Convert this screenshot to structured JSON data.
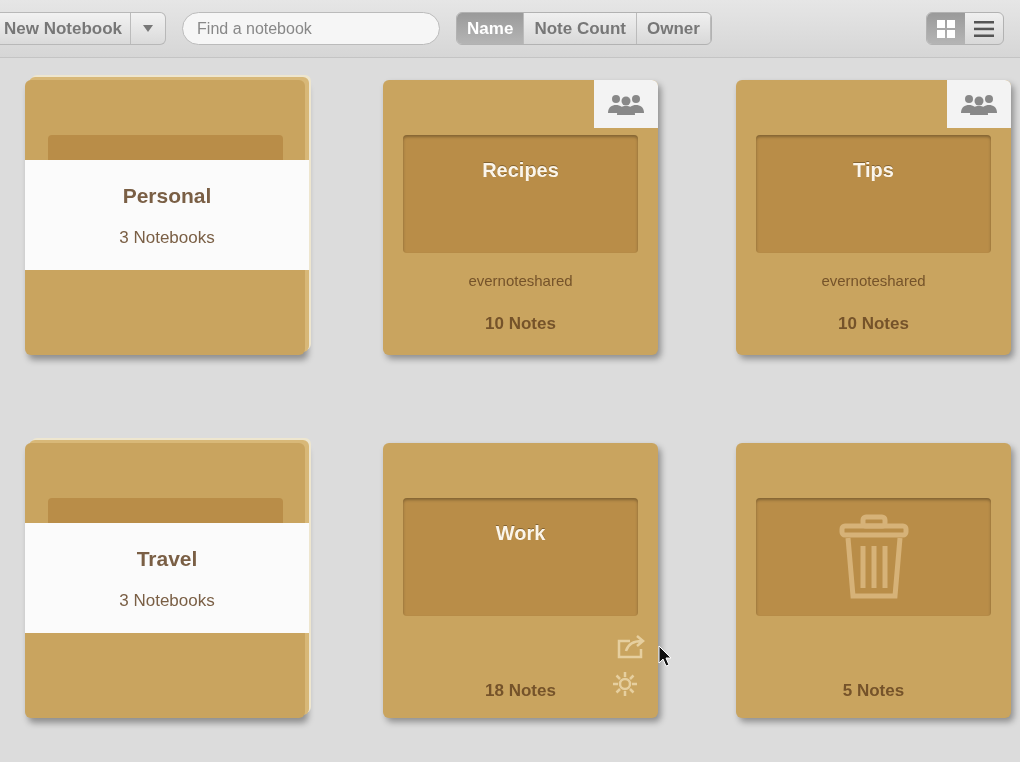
{
  "toolbar": {
    "new_button": "New Notebook",
    "search": {
      "placeholder": "Find a notebook"
    },
    "sort_tabs": [
      {
        "label": "Name",
        "selected": true
      },
      {
        "label": "Note Count",
        "selected": false
      },
      {
        "label": "Owner",
        "selected": false
      }
    ],
    "view_toggles": [
      {
        "kind": "grid",
        "selected": true
      },
      {
        "kind": "list",
        "selected": false
      }
    ]
  },
  "notebooks": [
    {
      "kind": "stack",
      "title": "Personal",
      "count": "3 Notebooks"
    },
    {
      "kind": "shared",
      "title": "Recipes",
      "owner": "evernoteshared",
      "count": "10 Notes"
    },
    {
      "kind": "shared",
      "title": "Tips",
      "owner": "evernoteshared",
      "count": "10 Notes"
    },
    {
      "kind": "stack",
      "title": "Travel",
      "count": "3 Notebooks"
    },
    {
      "kind": "notebook",
      "title": "Work",
      "count": "18 Notes",
      "hovered": true
    },
    {
      "kind": "trash",
      "count": "5 Notes"
    }
  ]
}
